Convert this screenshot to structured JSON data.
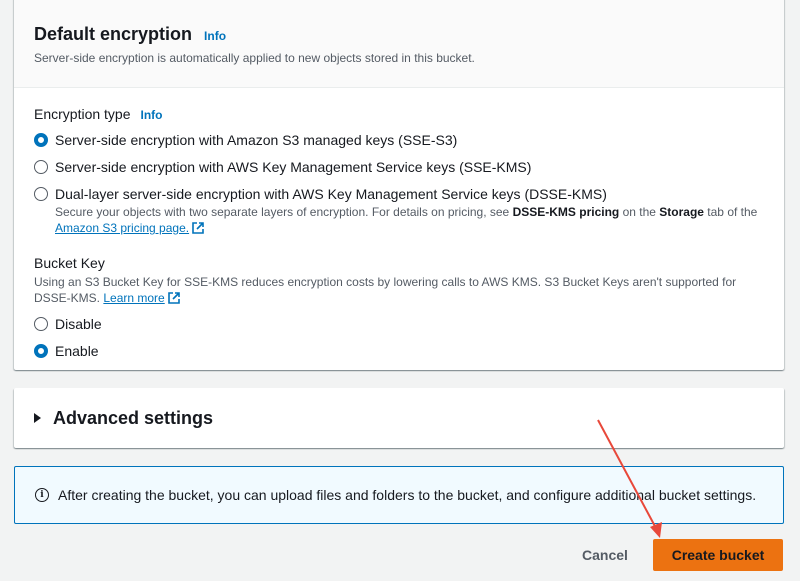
{
  "encryption": {
    "title": "Default encryption",
    "info": "Info",
    "subtitle": "Server-side encryption is automatically applied to new objects stored in this bucket.",
    "type_label": "Encryption type",
    "type_info": "Info",
    "options": [
      {
        "label": "Server-side encryption with Amazon S3 managed keys (SSE-S3)",
        "checked": true
      },
      {
        "label": "Server-side encryption with AWS Key Management Service keys (SSE-KMS)",
        "checked": false
      },
      {
        "label": "Dual-layer server-side encryption with AWS Key Management Service keys (DSSE-KMS)",
        "checked": false
      }
    ],
    "dsse_desc": {
      "part1": "Secure your objects with two separate layers of encryption. For details on pricing, see ",
      "bold1": "DSSE-KMS pricing",
      "part2": " on the ",
      "bold2": "Storage",
      "part3": " tab of the ",
      "link": "Amazon S3 pricing page."
    }
  },
  "bucket_key": {
    "label": "Bucket Key",
    "desc": "Using an S3 Bucket Key for SSE-KMS reduces encryption costs by lowering calls to AWS KMS. S3 Bucket Keys aren't supported for DSSE-KMS. ",
    "learn_more": "Learn more",
    "options": [
      {
        "label": "Disable",
        "checked": false
      },
      {
        "label": "Enable",
        "checked": true
      }
    ]
  },
  "advanced": {
    "title": "Advanced settings"
  },
  "alert": {
    "icon": "info-circle-icon",
    "text": "After creating the bucket, you can upload files and folders to the bucket, and configure additional bucket settings."
  },
  "actions": {
    "cancel": "Cancel",
    "create": "Create bucket"
  },
  "colors": {
    "primary_button": "#ec7211",
    "link": "#0073bb",
    "annotation_arrow": "#e8483a"
  }
}
